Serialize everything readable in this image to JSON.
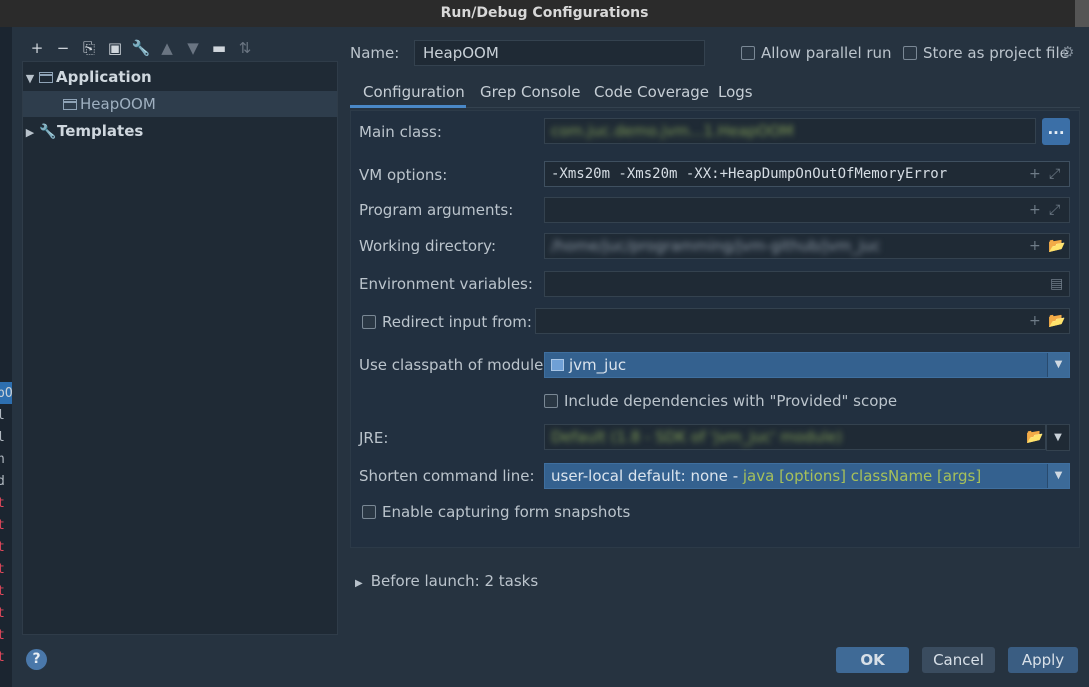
{
  "window": {
    "title": "Run/Debug Configurations"
  },
  "toolbar": {
    "buttons": [
      {
        "name": "add-icon",
        "glyph": "+"
      },
      {
        "name": "remove-icon",
        "glyph": "−"
      },
      {
        "name": "copy-icon",
        "glyph": "⎘"
      },
      {
        "name": "save-icon",
        "glyph": "▣"
      },
      {
        "name": "wrench-icon",
        "glyph": "🔧"
      },
      {
        "name": "move-up-icon",
        "glyph": "▲"
      },
      {
        "name": "move-down-icon",
        "glyph": "▼"
      },
      {
        "name": "new-folder-icon",
        "glyph": "▬"
      },
      {
        "name": "sort-icon",
        "glyph": "⇅"
      }
    ]
  },
  "tree": {
    "application": "Application",
    "heapoom": "HeapOOM",
    "templates": "Templates"
  },
  "header": {
    "name_label": "Name:",
    "name_value": "HeapOOM",
    "allow_parallel": "Allow parallel run",
    "store_as_file": "Store as project file"
  },
  "tabs": [
    "Configuration",
    "Grep Console",
    "Code Coverage",
    "Logs"
  ],
  "form": {
    "main_class_label": "Main class:",
    "main_class_value": "com.juc.demo.jvm...1.HeapOOM",
    "main_class_btn": "...",
    "vm_options_label": "VM options:",
    "vm_options_value": "-Xms20m -Xms20m -XX:+HeapDumpOnOutOfMemoryError",
    "program_args_label": "Program arguments:",
    "working_dir_label": "Working directory:",
    "working_dir_value": "/home/juc/programming/jvm-github/jvm_juc",
    "env_vars_label": "Environment variables:",
    "redirect_label": "Redirect input from:",
    "classpath_label": "Use classpath of module:",
    "classpath_value": "jvm_juc",
    "include_deps_label": "Include dependencies with \"Provided\" scope",
    "jre_label": "JRE:",
    "jre_value": "Default (1.8 - SDK of 'jvm_juc' module)",
    "shorten_label": "Shorten command line:",
    "shorten_value_prefix": "user-local default: none",
    "shorten_value_sep": " - ",
    "shorten_value_hint": "java [options] className [args]",
    "snapshots_label": "Enable capturing form snapshots"
  },
  "before_launch": "Before launch: 2 tasks",
  "buttons": {
    "ok": "OK",
    "cancel": "Cancel",
    "apply": "Apply",
    "help": "?"
  },
  "left_strip": [
    {
      "text": "pO",
      "color": "#c9d1d8"
    },
    {
      "text": "l",
      "color": "#b0b8c0"
    },
    {
      "text": "l",
      "color": "#b0b8c0"
    },
    {
      "text": "n",
      "color": "#b0b8c0"
    },
    {
      "text": "d",
      "color": "#b0b8c0"
    },
    {
      "text": "t",
      "color": "#e0475a"
    },
    {
      "text": "t",
      "color": "#e0475a"
    },
    {
      "text": "t",
      "color": "#e0475a"
    },
    {
      "text": "t",
      "color": "#e0475a"
    },
    {
      "text": "t",
      "color": "#e0475a"
    },
    {
      "text": "t",
      "color": "#e0475a"
    },
    {
      "text": "t",
      "color": "#e0475a"
    },
    {
      "text": "t",
      "color": "#e0475a"
    }
  ]
}
